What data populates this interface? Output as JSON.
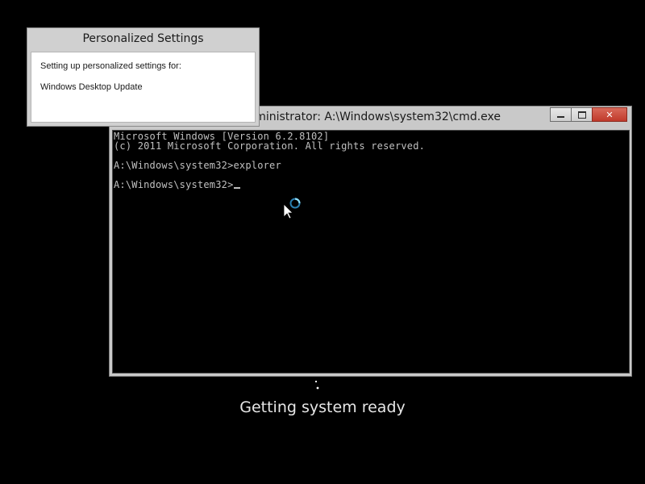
{
  "settings_dialog": {
    "title": "Personalized Settings",
    "line1": "Setting up personalized settings for:",
    "line2": "Windows Desktop Update"
  },
  "cmd_window": {
    "title": "Administrator: A:\\Windows\\system32\\cmd.exe",
    "controls": {
      "minimize_icon": "minimize-icon",
      "maximize_icon": "maximize-icon",
      "close_label": "✕"
    },
    "console_lines": [
      "Microsoft Windows [Version 6.2.8102]",
      "(c) 2011 Microsoft Corporation. All rights reserved.",
      "",
      "A:\\Windows\\system32>explorer",
      "",
      "A:\\Windows\\system32>"
    ]
  },
  "pointer": {
    "icon": "busy-pointer-icon"
  },
  "status": {
    "text": "Getting system ready",
    "indicator_icon": "loading-dots-icon"
  },
  "colors": {
    "background": "#000000",
    "console_text": "#c0c0c0",
    "close_button": "#c0392b",
    "spinner": "#3ab0e0"
  }
}
